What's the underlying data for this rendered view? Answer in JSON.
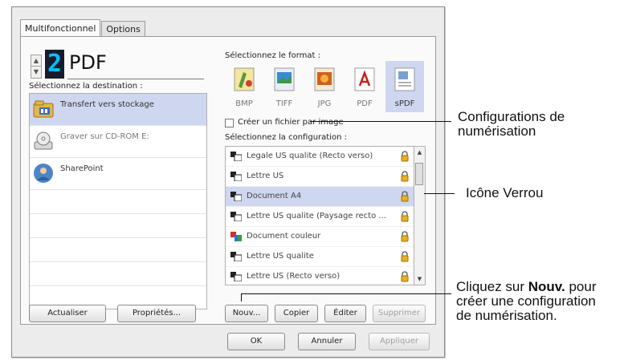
{
  "dialog": {
    "tabs": [
      "Multifonctionnel",
      "Options"
    ],
    "current_format": "PDF",
    "display_digit": "2",
    "destination_label": "Sélectionnez la destination :",
    "destinations": [
      {
        "label": "Transfert vers stockage",
        "icon": "storage-folder-icon",
        "selected": true
      },
      {
        "label": "Graver sur CD-ROM  E:",
        "icon": "cd-rom-icon",
        "selected": false
      },
      {
        "label": "SharePoint",
        "icon": "sharepoint-icon",
        "selected": false
      }
    ],
    "format_label": "Sélectionnez le format :",
    "formats": [
      {
        "label": "BMP",
        "icon": "bmp-icon",
        "selected": false
      },
      {
        "label": "TIFF",
        "icon": "tiff-icon",
        "selected": false
      },
      {
        "label": "JPG",
        "icon": "jpg-icon",
        "selected": false
      },
      {
        "label": "PDF",
        "icon": "pdf-icon",
        "selected": false
      },
      {
        "label": "sPDF",
        "icon": "spdf-icon",
        "selected": true
      }
    ],
    "checkbox_label": "Créer un fichier par image",
    "checkbox_checked": false,
    "config_label": "Sélectionnez la configuration :",
    "configs": [
      {
        "label": "Legale US qualite (Recto verso)",
        "icon": "config-icon",
        "selected": false
      },
      {
        "label": "Lettre US",
        "icon": "config-icon",
        "selected": false
      },
      {
        "label": "Document A4",
        "icon": "config-icon",
        "selected": true
      },
      {
        "label": "Lettre US qualite (Paysage recto ...",
        "icon": "config-icon",
        "selected": false
      },
      {
        "label": "Document couleur",
        "icon": "color-config-icon",
        "selected": false
      },
      {
        "label": "Lettre US qualite",
        "icon": "config-icon",
        "selected": false
      },
      {
        "label": "Lettre US (Recto verso)",
        "icon": "config-icon",
        "selected": false
      }
    ],
    "buttons": {
      "refresh": "Actualiser",
      "properties": "Propriétés...",
      "new": "Nouv...",
      "copy": "Copier",
      "edit": "Éditer",
      "delete": "Supprimer",
      "ok": "OK",
      "cancel": "Annuler",
      "apply": "Appliquer"
    }
  },
  "callouts": {
    "config_line1": "Configurations de",
    "config_line2": "numérisation",
    "lock": "Icône Verrou",
    "new_bold": "Nouv.",
    "new_line1_pre": "Cliquez sur ",
    "new_line1_post": " pour",
    "new_line2": "créer une configuration",
    "new_line3": "de numérisation."
  },
  "colors": {
    "selection": "#cfd7f0",
    "digit_display": "#00c0ff",
    "lock": "#e8b020"
  }
}
